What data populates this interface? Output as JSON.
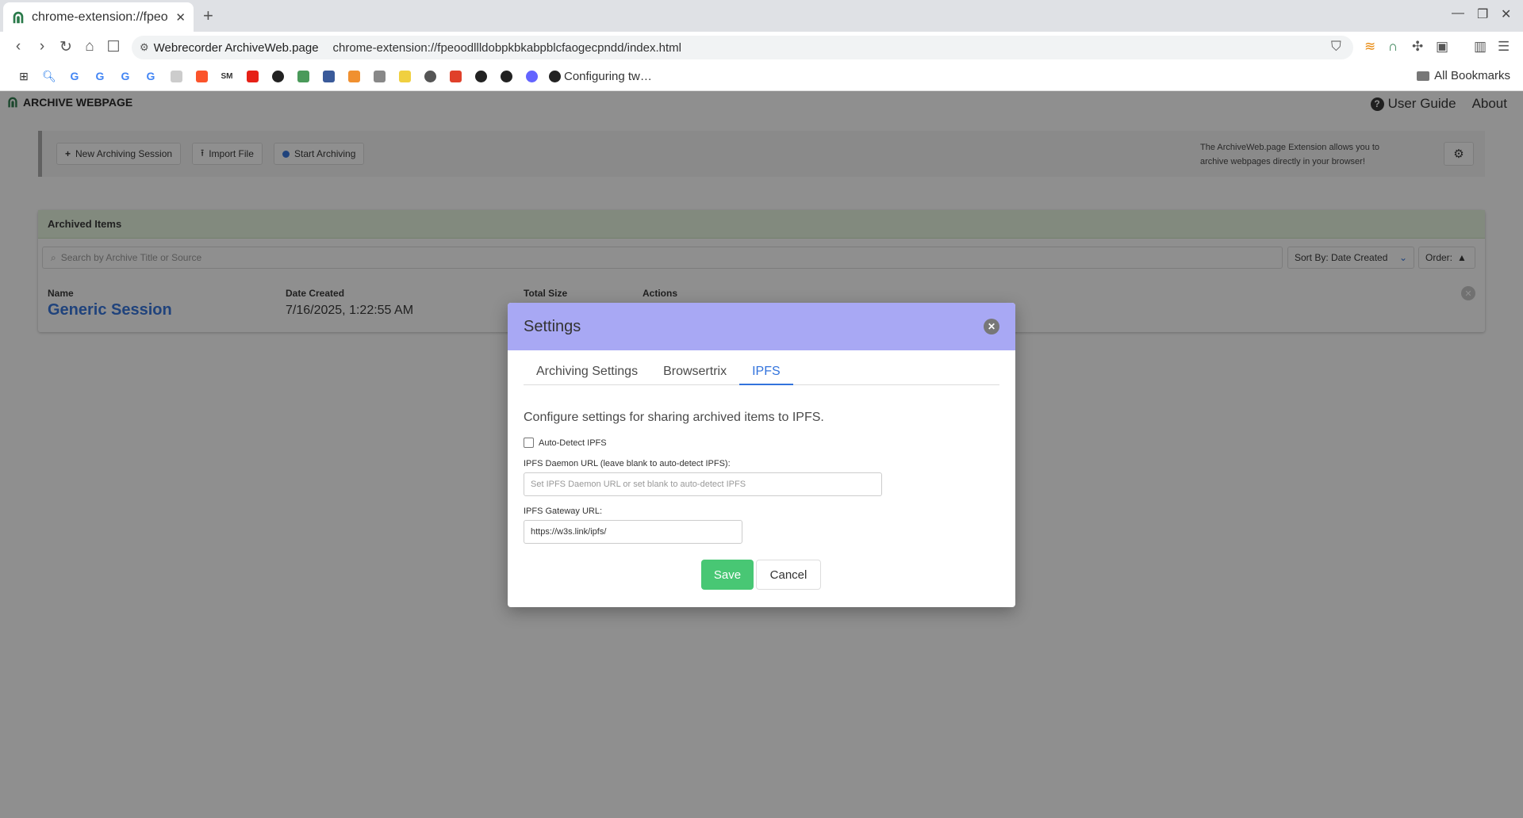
{
  "browser": {
    "tab_title": "chrome-extension://fpeo",
    "omnibox_site": "Webrecorder ArchiveWeb.page",
    "omnibox_url": "chrome-extension://fpeoodllldobpkbkabpblcfaogecpndd/index.html",
    "bookmark_last": "Configuring tw…",
    "all_bookmarks": "All Bookmarks"
  },
  "app": {
    "brand": "ARCHIVE WEBPAGE",
    "nav": {
      "user_guide": "User Guide",
      "about": "About"
    },
    "actions": {
      "new_session": "New Archiving Session",
      "import_file": "Import File",
      "start_archiving": "Start Archiving",
      "note": "The ArchiveWeb.page Extension allows you to archive webpages directly in your browser!"
    },
    "archived": {
      "header": "Archived Items",
      "search_placeholder": "Search by Archive Title or Source",
      "sort": "Sort By: Date Created",
      "order": "Order:",
      "columns": {
        "name": "Name",
        "date": "Date Created",
        "size": "Total Size",
        "actions": "Actions"
      },
      "rows": [
        {
          "name": "Generic Session",
          "date": "7/16/2025, 1:22:55 AM"
        }
      ]
    }
  },
  "modal": {
    "title": "Settings",
    "tabs": [
      "Archiving Settings",
      "Browsertrix",
      "IPFS"
    ],
    "active_tab": "IPFS",
    "description": "Configure settings for sharing archived items to IPFS.",
    "auto_detect_label": "Auto-Detect IPFS",
    "auto_detect_checked": false,
    "daemon_label": "IPFS Daemon URL (leave blank to auto-detect IPFS):",
    "daemon_placeholder": "Set IPFS Daemon URL or set blank to auto-detect IPFS",
    "gateway_label": "IPFS Gateway URL:",
    "gateway_value": "https://w3s.link/ipfs/",
    "save": "Save",
    "cancel": "Cancel"
  },
  "colors": {
    "modal_header": "#a8a8f4",
    "save_button": "#48c774",
    "link": "#3273dc",
    "archived_header": "#e8f5e0"
  }
}
